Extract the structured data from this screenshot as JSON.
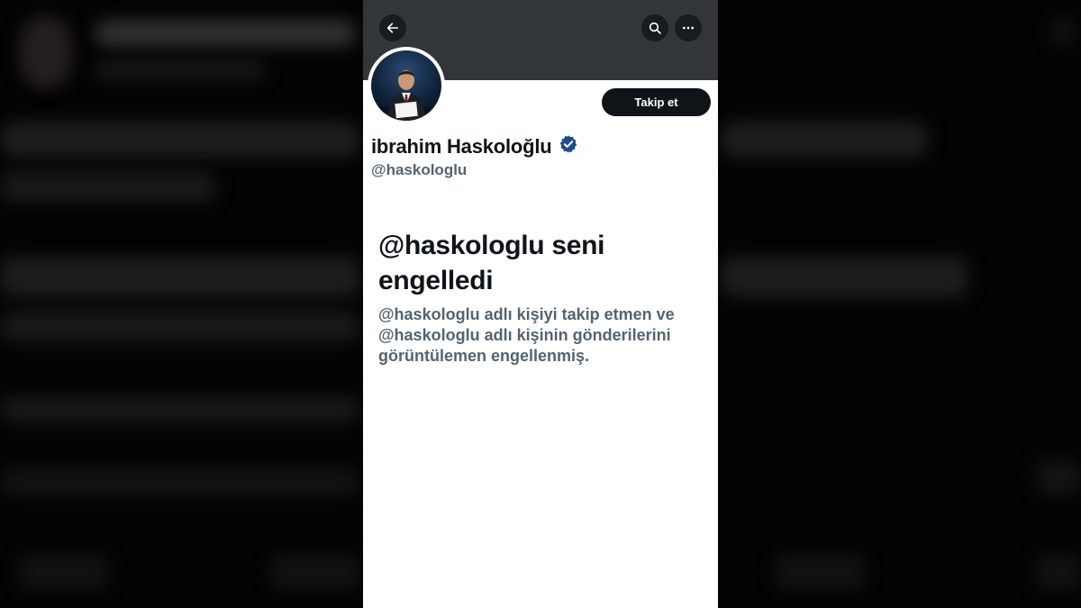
{
  "profile": {
    "display_name": "ibrahim Haskoloğlu",
    "handle": "@haskologlu",
    "verified": true,
    "verified_icon": "verified-badge-icon",
    "verified_color": "#1d4e89"
  },
  "header": {
    "back_icon": "back-arrow-icon",
    "search_icon": "search-icon",
    "more_icon": "more-icon"
  },
  "actions": {
    "follow_label": "Takip et"
  },
  "blocked": {
    "title": "@haskologlu seni engelledi",
    "description": "@haskologlu adlı kişiyi takip etmen ve @haskologlu adlı kişinin gönderilerini görüntülemen engellenmiş."
  },
  "colors": {
    "banner": "#333639",
    "primary_text": "#0f1419",
    "secondary_text": "#536471",
    "follow_button": "#0f1419"
  }
}
